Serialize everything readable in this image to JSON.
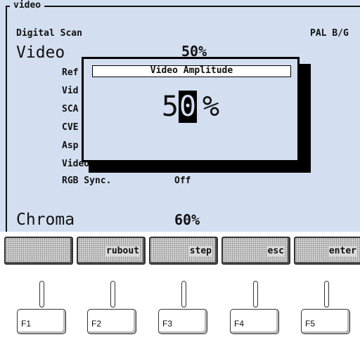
{
  "screen": {
    "tab_title": "video",
    "section_label": "Digital Scan",
    "standard": "PAL B/G",
    "video_label": "Video",
    "video_value": "50%",
    "rows": [
      {
        "label": "Ref",
        "value": ""
      },
      {
        "label": "Vid",
        "value": ""
      },
      {
        "label": "SCA",
        "value": ""
      },
      {
        "label": "CVE",
        "value": ""
      },
      {
        "label": "Asp",
        "value": ""
      },
      {
        "label": "Video",
        "value": ""
      },
      {
        "label": "RGB Sync.",
        "value": "Off"
      }
    ],
    "chroma_label": "Chroma",
    "chroma_value": "60%"
  },
  "popup": {
    "title": "Video Amplitude",
    "value_digit_1": "5",
    "value_digit_cursor": "0",
    "unit": "%"
  },
  "softkeys": [
    {
      "label": ""
    },
    {
      "label": "rubout"
    },
    {
      "label": "step"
    },
    {
      "label": "esc"
    },
    {
      "label": "enter"
    }
  ],
  "function_keys": [
    "F1",
    "F2",
    "F3",
    "F4",
    "F5"
  ]
}
